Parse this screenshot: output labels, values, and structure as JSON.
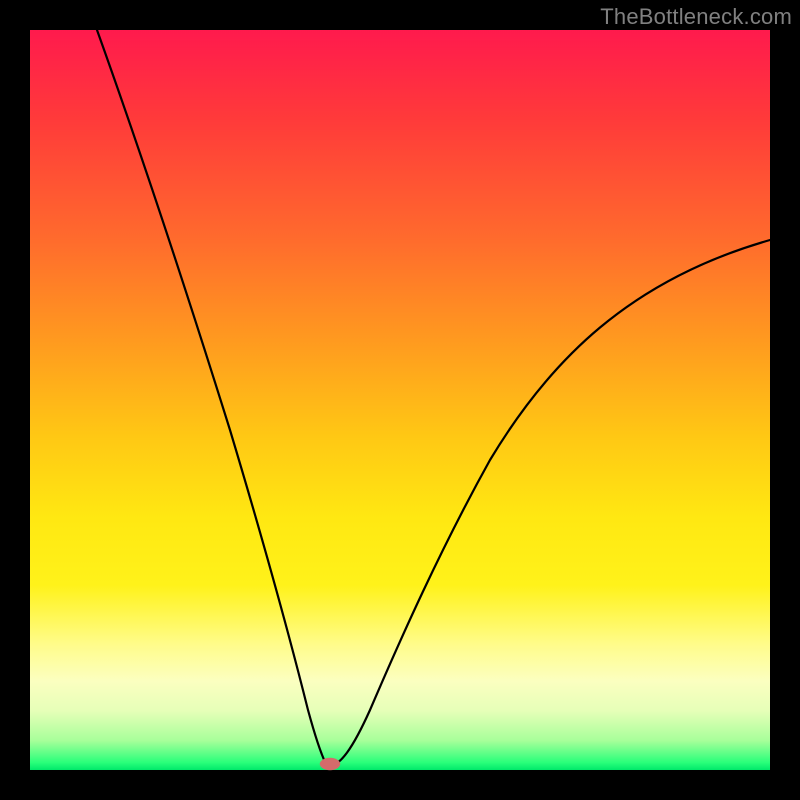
{
  "watermark": "TheBottleneck.com",
  "colors": {
    "background": "#000000",
    "curve": "#000000",
    "marker": "#d56b6b",
    "gradient_stops": [
      "#ff1a4d",
      "#ff3a3a",
      "#ff6a2d",
      "#ff9a1f",
      "#ffc814",
      "#ffe812",
      "#fff21a",
      "#fffc8a",
      "#fbffc0",
      "#e6ffb8",
      "#a8ff9a",
      "#29ff7a",
      "#00e86a"
    ]
  },
  "chart_data": {
    "type": "line",
    "title": "",
    "xlabel": "",
    "ylabel": "",
    "xlim": [
      0,
      100
    ],
    "ylim": [
      0,
      100
    ],
    "grid": false,
    "legend": false,
    "series": [
      {
        "name": "bottleneck-curve",
        "x": [
          9,
          12,
          15,
          18,
          21,
          24,
          27,
          30,
          33,
          35,
          37,
          38,
          39,
          40,
          42,
          45,
          48,
          52,
          56,
          60,
          66,
          72,
          80,
          88,
          96,
          100
        ],
        "y": [
          100,
          88,
          77,
          66,
          56,
          46,
          37,
          28,
          19,
          12,
          6,
          3,
          1,
          0.5,
          1,
          4,
          9,
          16,
          24,
          32,
          42,
          50,
          58,
          64,
          69,
          71
        ]
      }
    ],
    "marker": {
      "x": 40,
      "y": 0.5
    }
  }
}
